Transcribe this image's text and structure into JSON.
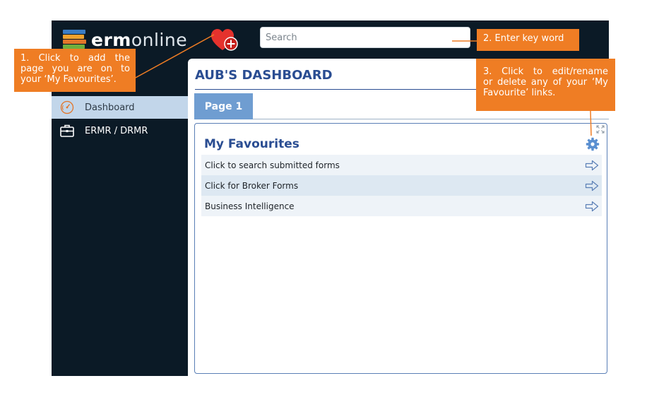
{
  "app": {
    "logo": {
      "bold": "erm",
      "light": "online"
    },
    "search": {
      "placeholder": "Search",
      "value": ""
    },
    "colors": {
      "accent": "#ef7d24",
      "nav": "#0b1a26",
      "brand_blue": "#2a4d92",
      "heart": "#e5322d"
    }
  },
  "sidebar": {
    "items": [
      {
        "label": "Dashboard",
        "icon": "speedometer-icon",
        "selected": true
      },
      {
        "label": "ERMR / DRMR",
        "icon": "briefcase-icon",
        "selected": false
      }
    ]
  },
  "main": {
    "title": "AUB'S DASHBOARD",
    "tabs": [
      {
        "label": "Page 1",
        "active": true
      }
    ],
    "panel": {
      "title": "My Favourites",
      "items": [
        {
          "label": "Click to search submitted forms"
        },
        {
          "label": "Click for Broker Forms"
        },
        {
          "label": "Business Intelligence"
        }
      ]
    }
  },
  "callouts": {
    "add_favourite": {
      "line1": "1. Click to add the",
      "line2": "page you are on to",
      "line3": "your ‘My Favourites’."
    },
    "search": {
      "text": "2. Enter key word"
    },
    "edit": {
      "line1": "3. Click to edit/rename",
      "line2": "or delete any of your ‘My",
      "line3": "Favourite’ links."
    }
  }
}
